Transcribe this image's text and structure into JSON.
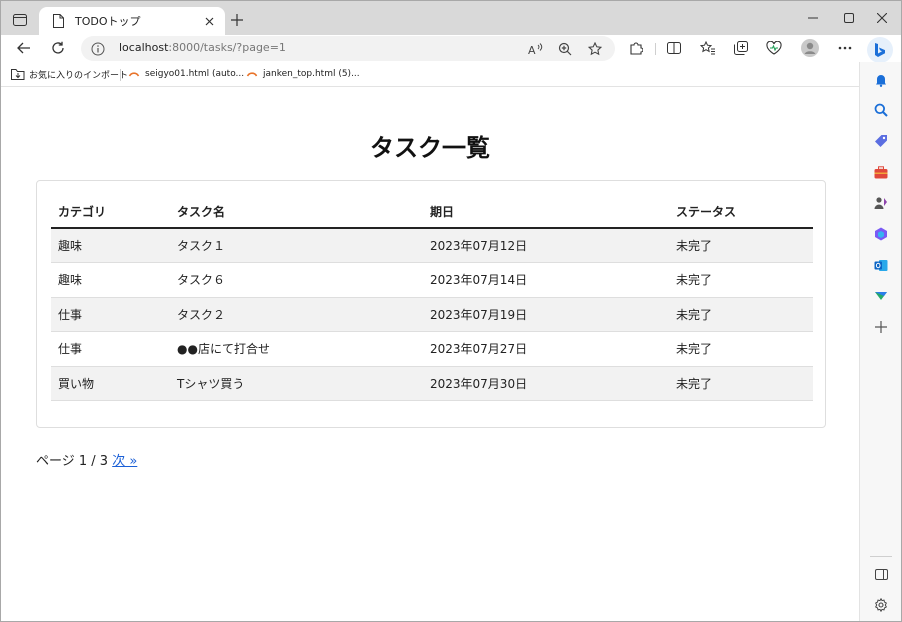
{
  "browser": {
    "tab_title": "TODOトップ",
    "url_host": "localhost",
    "url_rest": ":8000/tasks/?page=1",
    "favorites": [
      {
        "label": "お気に入りのインポート"
      },
      {
        "label": "seigyo01.html (auto..."
      },
      {
        "label": "janken_top.html (5)..."
      }
    ],
    "colors": {
      "link": "#1a5fd6",
      "tab_strip": "#d9d9d9"
    }
  },
  "page": {
    "title": "タスク一覧",
    "table": {
      "headers": [
        "カテゴリ",
        "タスク名",
        "期日",
        "ステータス"
      ],
      "rows": [
        [
          "趣味",
          "タスク１",
          "2023年07月12日",
          "未完了"
        ],
        [
          "趣味",
          "タスク６",
          "2023年07月14日",
          "未完了"
        ],
        [
          "仕事",
          "タスク２",
          "2023年07月19日",
          "未完了"
        ],
        [
          "仕事",
          "●●店にて打合せ",
          "2023年07月27日",
          "未完了"
        ],
        [
          "買い物",
          "Tシャツ買う",
          "2023年07月30日",
          "未完了"
        ]
      ]
    },
    "pagination": {
      "label": "ページ 1 / 3",
      "next_label": "次 »"
    }
  }
}
